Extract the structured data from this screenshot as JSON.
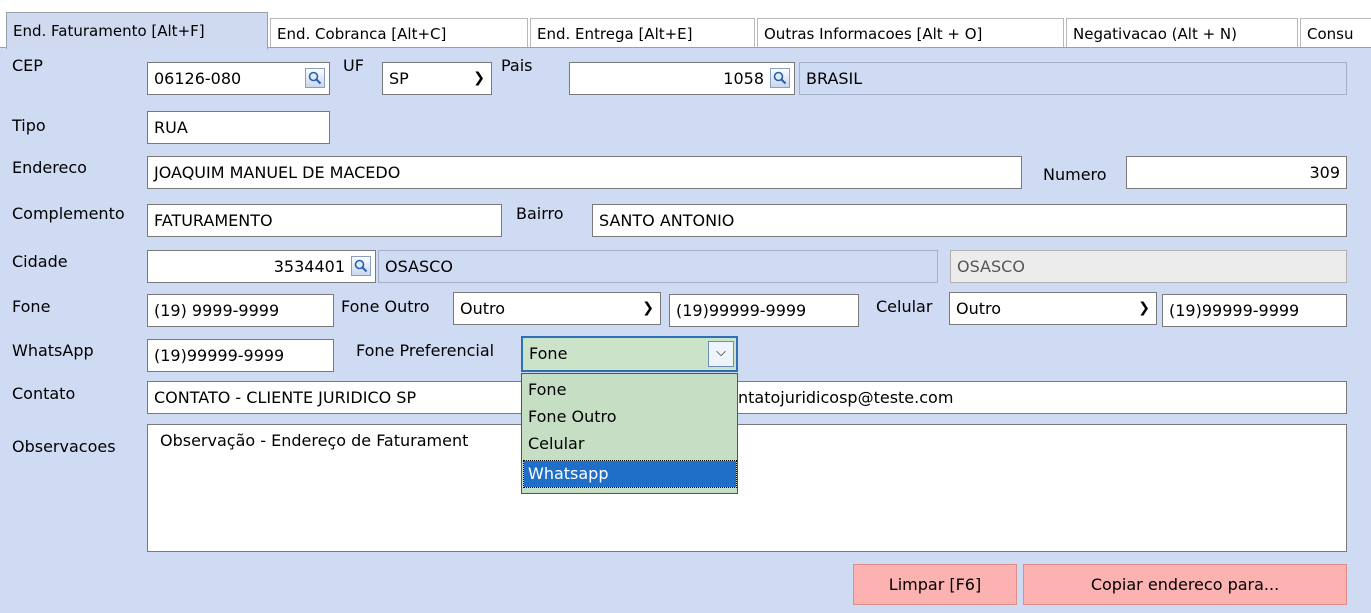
{
  "tabs": [
    {
      "label": "End. Faturamento [Alt+F]",
      "active": true
    },
    {
      "label": "End. Cobranca [Alt+C]"
    },
    {
      "label": "End. Entrega [Alt+E]"
    },
    {
      "label": "Outras Informacoes [Alt + O]"
    },
    {
      "label": "Negativacao (Alt + N)"
    },
    {
      "label": "Consu"
    }
  ],
  "labels": {
    "cep": "CEP",
    "uf": "UF",
    "pais": "Pais",
    "tipo": "Tipo",
    "endereco": "Endereco",
    "numero": "Numero",
    "complemento": "Complemento",
    "bairro": "Bairro",
    "cidade": "Cidade",
    "fone": "Fone",
    "fone_outro": "Fone Outro",
    "celular": "Celular",
    "whatsapp": "WhatsApp",
    "fone_preferencial": "Fone Preferencial",
    "contato": "Contato",
    "observacoes": "Observacoes"
  },
  "fields": {
    "cep": "06126-080",
    "uf": "SP",
    "pais_code": "1058",
    "pais_name": "BRASIL",
    "tipo": "RUA",
    "endereco": "JOAQUIM MANUEL DE MACEDO",
    "numero": "309",
    "complemento": "FATURAMENTO",
    "bairro": "SANTO ANTONIO",
    "cidade_code": "3534401",
    "cidade_name": "OSASCO",
    "cidade_name2": "OSASCO",
    "fone": "(19) 9999-9999",
    "fone_outro_type": "Outro",
    "fone_outro": "(19)99999-9999",
    "celular_type": "Outro",
    "celular": "(19)99999-9999",
    "whatsapp": "(19)99999-9999",
    "contato": "CONTATO - CLIENTE JURIDICO SP",
    "email_partial": "ntatojuridicosp@teste.com",
    "observacoes": "Observação - Endereço de Faturament"
  },
  "fone_preferencial": {
    "selected": "Fone",
    "options": [
      "Fone",
      "Fone Outro",
      "Celular",
      "Whatsapp"
    ],
    "highlighted": "Whatsapp"
  },
  "buttons": {
    "limpar": "Limpar [F6]",
    "copiar": "Copiar endereco para..."
  },
  "icons": {
    "search": "search-icon",
    "dropdown": "chevron-down-icon"
  }
}
